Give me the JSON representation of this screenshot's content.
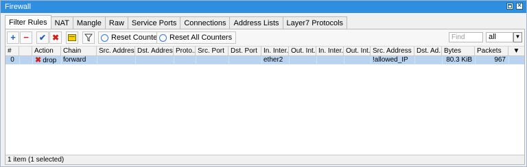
{
  "window": {
    "title": "Firewall"
  },
  "tabs": [
    {
      "label": "Filter Rules",
      "active": true
    },
    {
      "label": "NAT"
    },
    {
      "label": "Mangle"
    },
    {
      "label": "Raw"
    },
    {
      "label": "Service Ports"
    },
    {
      "label": "Connections"
    },
    {
      "label": "Address Lists"
    },
    {
      "label": "Layer7 Protocols"
    }
  ],
  "toolbar": {
    "add_glyph": "+",
    "remove_glyph": "−",
    "enable_glyph": "✔",
    "disable_glyph": "✖",
    "reset_counters_label": "Reset Counters",
    "reset_all_counters_label": "Reset All Counters",
    "find_placeholder": "Find",
    "filter_value": "all"
  },
  "table": {
    "columns": [
      "#",
      "",
      "Action",
      "Chain",
      "Src. Address",
      "Dst. Address",
      "Proto...",
      "Src. Port",
      "Dst. Port",
      "In. Inter...",
      "Out. Int...",
      "In. Inter...",
      "Out. Int...",
      "Src. Address ...",
      "Dst. Ad...",
      "Bytes",
      "Packets"
    ],
    "rows": [
      {
        "num": "0",
        "action": "drop",
        "chain": "forward",
        "in_interface": "ether2",
        "src_address_list": "!allowed_IP",
        "bytes": "80.3 KiB",
        "packets": "967"
      }
    ]
  },
  "status": {
    "text": "1 item (1 selected)"
  },
  "colors": {
    "titlebar": "#2f8ee0",
    "selected_row": "#b9d3f0",
    "add": "#1f5fbf",
    "remove": "#cc2222"
  }
}
